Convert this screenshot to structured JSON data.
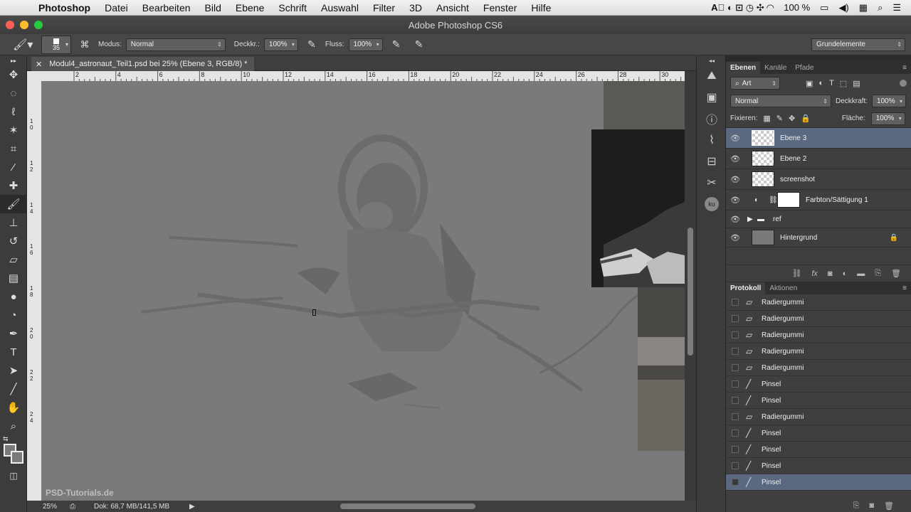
{
  "menubar": {
    "app": "Photoshop",
    "items": [
      "Datei",
      "Bearbeiten",
      "Bild",
      "Ebene",
      "Schrift",
      "Auswahl",
      "Filter",
      "3D",
      "Ansicht",
      "Fenster",
      "Hilfe"
    ],
    "battery": "100 %"
  },
  "window": {
    "title": "Adobe Photoshop CS6"
  },
  "options": {
    "brush_size": "35",
    "mode_label": "Modus:",
    "mode_value": "Normal",
    "opacity_label": "Deckkr.:",
    "opacity_value": "100%",
    "flow_label": "Fluss:",
    "flow_value": "100%",
    "workspace": "Grundelemente"
  },
  "document": {
    "tab_title": "Modul4_astronaut_Teil1.psd bei 25% (Ebene 3, RGB/8) *",
    "ruler_h_ticks": [
      "2",
      "4",
      "6",
      "8",
      "10",
      "12",
      "14",
      "16",
      "18",
      "20",
      "22",
      "24",
      "26",
      "28",
      "30"
    ],
    "ruler_v_ticks": [
      "1 0",
      "1 2",
      "1 4",
      "1 6",
      "1 8",
      "2 0",
      "2 2",
      "2 4"
    ],
    "zoom": "25%",
    "doc_size": "Dok: 68,7 MB/141,5 MB",
    "watermark": "PSD-Tutorials.de"
  },
  "layers_panel": {
    "tabs": [
      "Ebenen",
      "Kanäle",
      "Pfade"
    ],
    "filter_kind": "Art",
    "blend_mode": "Normal",
    "opacity_label": "Deckkraft:",
    "opacity_value": "100%",
    "lock_label": "Fixieren:",
    "fill_label": "Fläche:",
    "fill_value": "100%",
    "layers": [
      {
        "name": "Ebene 3",
        "selected": true
      },
      {
        "name": "Ebene 2",
        "selected": false
      },
      {
        "name": "screenshot",
        "selected": false
      },
      {
        "name": "Farbton/Sättigung 1",
        "selected": false
      },
      {
        "name": "ref",
        "selected": false
      },
      {
        "name": "Hintergrund",
        "selected": false
      }
    ]
  },
  "history_panel": {
    "tabs": [
      "Protokoll",
      "Aktionen"
    ],
    "items": [
      {
        "label": "Radiergummi",
        "icon": "eraser-icon"
      },
      {
        "label": "Radiergummi",
        "icon": "eraser-icon"
      },
      {
        "label": "Radiergummi",
        "icon": "eraser-icon"
      },
      {
        "label": "Radiergummi",
        "icon": "eraser-icon"
      },
      {
        "label": "Radiergummi",
        "icon": "eraser-icon"
      },
      {
        "label": "Pinsel",
        "icon": "brush-icon"
      },
      {
        "label": "Pinsel",
        "icon": "brush-icon"
      },
      {
        "label": "Radiergummi",
        "icon": "eraser-icon"
      },
      {
        "label": "Pinsel",
        "icon": "brush-icon"
      },
      {
        "label": "Pinsel",
        "icon": "brush-icon"
      },
      {
        "label": "Pinsel",
        "icon": "brush-icon"
      },
      {
        "label": "Pinsel",
        "icon": "brush-icon"
      }
    ]
  }
}
